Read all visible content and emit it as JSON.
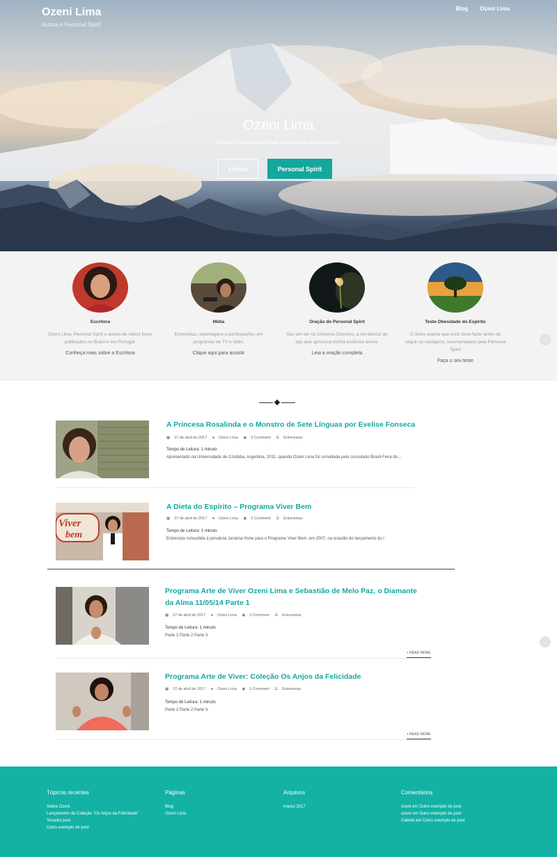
{
  "site": {
    "title": "Ozeni Lima",
    "tagline": "Autora e Personal Spirit"
  },
  "nav": {
    "items": [
      "Blog",
      "Ozeni Lima"
    ]
  },
  "hero": {
    "title": "Ozeni Lima",
    "subtitle": "De que maneira você está alimentando seu espírito?",
    "btn_livros": "Livros",
    "btn_personal": "Personal Spirit"
  },
  "features": [
    {
      "title": "Escritora",
      "desc": "Ozeni Lima, Personal Spirit e autora de vários livros publicados no Brasil e em Portugal.",
      "link": "Conheça mais sobre a Escritora"
    },
    {
      "title": "Mídia",
      "desc": "Entrevistas, reportagens e participações em programas de TV e rádio.",
      "link": "Clique aqui para assistir"
    },
    {
      "title": "Oração do Personal Spirit",
      "desc": "Sou um ser no Universo Cósmico, a me libertar do ego que aprisiona minha essência divina.",
      "link": "Leia a oração completa"
    },
    {
      "title": "Teste Obesidade do Espírito",
      "desc": "O único exame que você deve fazer antes de seguir os cardápios, recomendados pela Personal Spirit",
      "link": "Faça o seu teste"
    }
  ],
  "posts": [
    {
      "title": "A Princesa Rosalinda e o Monstro de Sete Línguas por Evelise Fonseca",
      "date": "27 de abril de 2017",
      "author": "Ozeni Lima",
      "comments": "0 Comment",
      "category": "Entrevistas",
      "reading": "Tempo de Leitura: 1 minuto",
      "excerpt": "Apresentado na Universidade de Córdoba, Argentina, 2011, quando Ozeni Lima foi convidada pelo consulado Brasil-Feira do…"
    },
    {
      "title": "A Dieta do Espírito – Programa Viver Bem",
      "date": "27 de abril de 2017",
      "author": "Ozeni Lima",
      "comments": "0 Comment",
      "category": "Entrevistas",
      "reading": "Tempo de Leitura: 1 minuto",
      "excerpt": "Entrevista concedida à jornalista Janaína Hone para o Programe Viver Bem, em 2007, na ocasião do lançamento do l",
      "thumb_text": "Viver bem"
    },
    {
      "title": "Programa Arte de Viver Ozeni Lima e Sebastião de Melo Paz, o Diamante da Alma 11/05/14 Parte 1",
      "date": "27 de abril de 2017",
      "author": "Ozeni Lima",
      "comments": "0 Comment",
      "category": "Entrevistas",
      "reading": "Tempo de Leitura: 1 minuto",
      "excerpt": "Parte 1 Parte 2 Parte 3",
      "read_more": "+ READ MORE"
    },
    {
      "title": "Programa Arte de Viver: Coleção Os Anjos da Felicidade",
      "date": "27 de abril de 2017",
      "author": "Ozeni Lima",
      "comments": "0 Comment",
      "category": "Entrevistas",
      "reading": "Tempo de Leitura: 1 minuto",
      "excerpt": "Parte 1 Parte 2 Parte 3",
      "read_more": "+ READ MORE"
    }
  ],
  "footer": {
    "recent_title": "Tópicos recentes",
    "recent": [
      "Sobre Ozeni",
      "Lançamento da Coleção \"Os Anjos da Felicidade\"",
      "Terceiro post",
      "Outro exemplo de post"
    ],
    "pages_title": "Páginas",
    "pages": [
      "Blog",
      "Ozeni Lima"
    ],
    "archives_title": "Arquivos",
    "archives": [
      "março 2017"
    ],
    "comments_title": "Comentários",
    "comments": [
      "ozeni em Outro exemplo de post",
      "ozeni em Outro exemplo de post",
      "Gabriel em Outro exemplo de post"
    ]
  },
  "colors": {
    "accent": "#13a89e",
    "footer_bg": "#13b2a4",
    "features_bg": "#f3f3f3"
  }
}
